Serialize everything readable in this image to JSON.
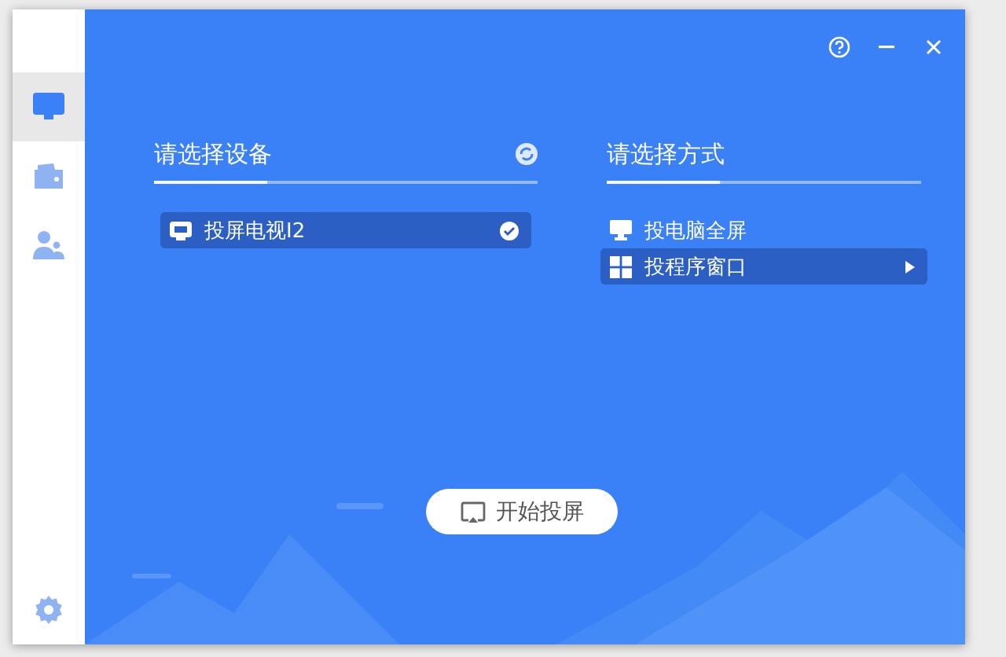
{
  "sidebar": {
    "items": [
      {
        "kind": "monitor",
        "selected": true
      },
      {
        "kind": "wallet",
        "selected": false
      },
      {
        "kind": "people",
        "selected": false
      }
    ]
  },
  "title_bar": {
    "buttons": [
      {
        "kind": "help"
      },
      {
        "kind": "minimize"
      },
      {
        "kind": "close"
      }
    ]
  },
  "device_panel": {
    "title": "请选择设备",
    "devices": [
      {
        "label": "投屏电视I2",
        "selected": true
      }
    ]
  },
  "mode_panel": {
    "title": "请选择方式",
    "modes": [
      {
        "kind": "monitor",
        "label": "投电脑全屏",
        "selected": false
      },
      {
        "kind": "windows",
        "label": "投程序窗口",
        "selected": true
      }
    ]
  },
  "start_button": {
    "label": "开始投屏"
  }
}
